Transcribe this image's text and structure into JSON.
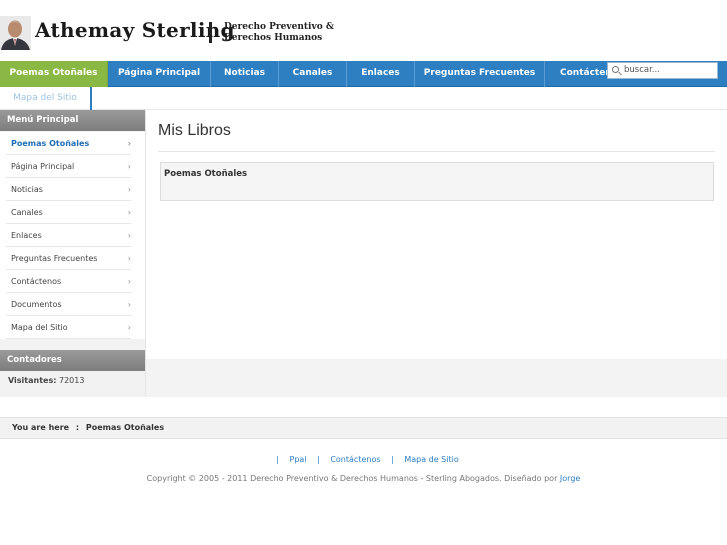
{
  "header": {
    "name": "Athemay Sterling",
    "tagline_line1": "Derecho Preventivo &",
    "tagline_line2": "Derechos Humanos"
  },
  "nav": {
    "items": [
      "Poemas Otoñales",
      "Página Principal",
      "Noticias",
      "Canales",
      "Enlaces",
      "Preguntas Frecuentes",
      "Contáctenos"
    ],
    "active_index": 0,
    "second_row": "Mapa del Sitio"
  },
  "search": {
    "placeholder": "buscar..."
  },
  "sidebar": {
    "menu_title": "Menú Principal",
    "items": [
      "Poemas Otoñales",
      "Página Principal",
      "Noticias",
      "Canales",
      "Enlaces",
      "Preguntas Frecuentes",
      "Contáctenos",
      "Documentos",
      "Mapa del Sitio"
    ],
    "arrow": "›",
    "counters_title": "Contadores",
    "visitors_label": "Visitantes:",
    "visitors_value": "72013"
  },
  "main": {
    "title": "Mis Libros",
    "article_title": "Poemas Otoñales"
  },
  "breadcrumb": {
    "prefix": "You are here",
    "separator": ":",
    "current": "Poemas Otoñales"
  },
  "footer": {
    "links": [
      "Ppal",
      "Contáctenos",
      "Mapa de Sitio"
    ],
    "link_separator": "|",
    "copyright": "Copyright © 2005 - 2011 Derecho Preventivo & Derechos Humanos - Sterling Abogados. Diseñado por",
    "designer": "Jorge"
  },
  "colors": {
    "nav_blue": "#2d7fc2",
    "nav_active_green": "#8ab845",
    "link_blue": "#1f6eb5"
  }
}
